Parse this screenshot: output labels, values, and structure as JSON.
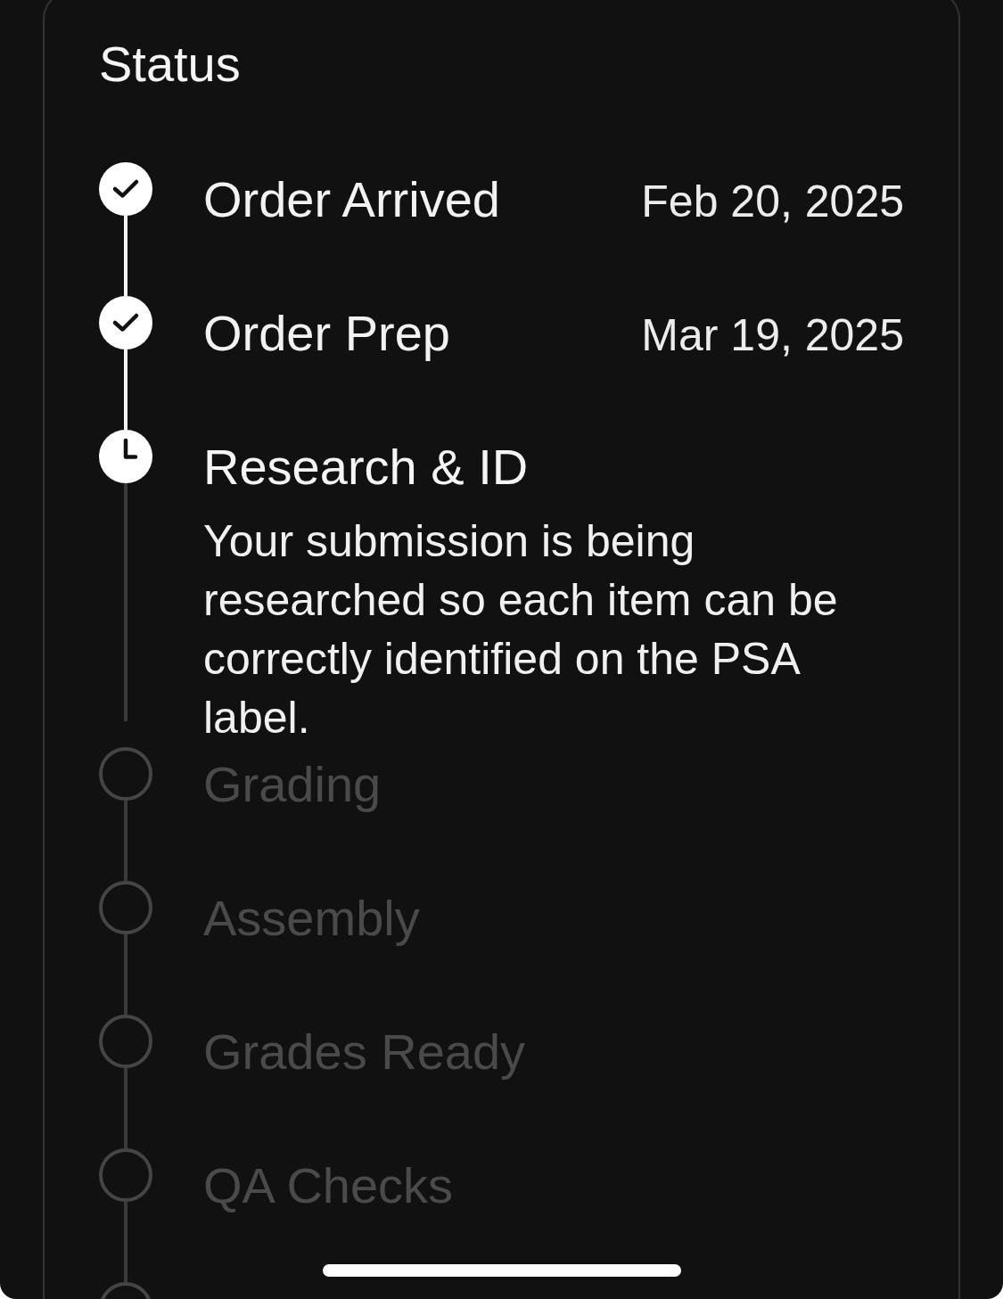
{
  "card": {
    "title": "Status"
  },
  "steps": [
    {
      "title": "Order Arrived",
      "date": "Feb 20, 2025",
      "kind": "done"
    },
    {
      "title": "Order Prep",
      "date": "Mar 19, 2025",
      "kind": "done"
    },
    {
      "title": "Research & ID",
      "kind": "current",
      "description": "Your submission is being researched so each item can be correctly identified on the PSA label."
    },
    {
      "title": "Grading",
      "kind": "pending"
    },
    {
      "title": "Assembly",
      "kind": "pending"
    },
    {
      "title": "Grades Ready",
      "kind": "pending"
    },
    {
      "title": "QA Checks",
      "kind": "pending"
    },
    {
      "kind": "pending"
    }
  ]
}
